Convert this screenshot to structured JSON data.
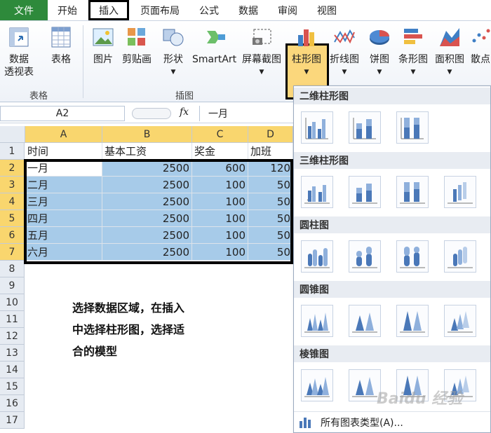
{
  "menu": {
    "tabs": [
      "文件",
      "开始",
      "插入",
      "页面布局",
      "公式",
      "数据",
      "审阅",
      "视图"
    ],
    "active_tab": "插入"
  },
  "ribbon": {
    "buttons": {
      "pivot": [
        "数据",
        "透视表"
      ],
      "table": "表格",
      "picture": "图片",
      "clipart": "剪贴画",
      "shapes": "形状",
      "smartart": "SmartArt",
      "screenshot": "屏幕截图",
      "column_chart": "柱形图",
      "line_chart": "折线图",
      "pie_chart": "饼图",
      "bar_chart": "条形图",
      "area_chart": "面积图",
      "scatter_chart": "散点"
    },
    "groups": {
      "tables": "表格",
      "illustrations": "插图"
    }
  },
  "formula_bar": {
    "name_box": "A2",
    "fx": "fx",
    "formula": "一月"
  },
  "sheet": {
    "columns": [
      "A",
      "B",
      "C",
      "D"
    ],
    "rows": [
      "1",
      "2",
      "3",
      "4",
      "5",
      "6",
      "7",
      "8",
      "9",
      "10",
      "11",
      "12",
      "13",
      "14",
      "15",
      "16",
      "17"
    ],
    "header": [
      "时间",
      "基本工资",
      "奖金",
      "加班"
    ],
    "data": [
      [
        "一月",
        "2500",
        "600",
        "120"
      ],
      [
        "二月",
        "2500",
        "100",
        "50"
      ],
      [
        "三月",
        "2500",
        "100",
        "50"
      ],
      [
        "四月",
        "2500",
        "100",
        "50"
      ],
      [
        "五月",
        "2500",
        "100",
        "50"
      ],
      [
        "六月",
        "2500",
        "100",
        "50"
      ]
    ]
  },
  "note": {
    "line1": "选择数据区域，在插入",
    "line2": "中选择柱形图，选择适",
    "line3": "合的模型"
  },
  "dropdown": {
    "sections": [
      "二维柱形图",
      "三维柱形图",
      "圆柱图",
      "圆锥图",
      "棱锥图"
    ],
    "footer": "所有图表类型(A)..."
  },
  "watermark": "Baidu 经验",
  "colors": {
    "file_tab": "#2e8a3b",
    "selection": "#a7cbe9",
    "header_highlight": "#f9d66e",
    "ribbon_highlight": "#fbd77c"
  }
}
